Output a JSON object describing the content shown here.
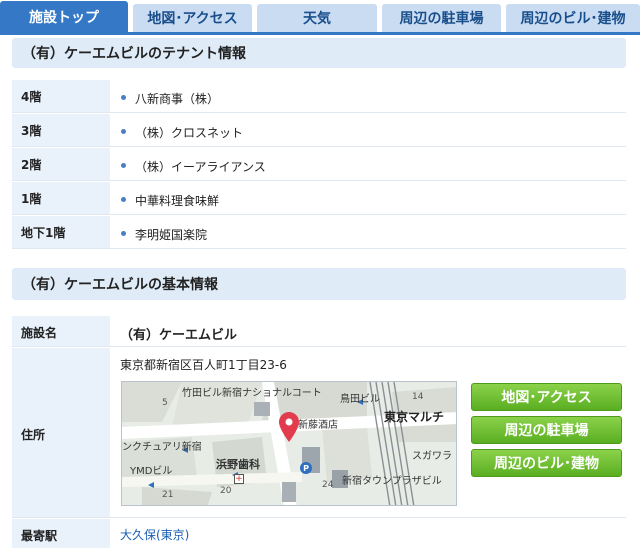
{
  "tabs": [
    {
      "label": "施設トップ",
      "active": true
    },
    {
      "label": "地図･アクセス",
      "active": false
    },
    {
      "label": "天気",
      "active": false
    },
    {
      "label": "周辺の駐車場",
      "active": false
    },
    {
      "label": "周辺のビル･建物",
      "active": false
    }
  ],
  "tenant_section": {
    "title": "（有）ケーエムビルのテナント情報",
    "rows": [
      {
        "floor": "4階",
        "tenant": "八新商事（株）"
      },
      {
        "floor": "3階",
        "tenant": "（株）クロスネット"
      },
      {
        "floor": "2階",
        "tenant": "（株）イーアライアンス"
      },
      {
        "floor": "1階",
        "tenant": "中華料理食味鮮"
      },
      {
        "floor": "地下1階",
        "tenant": "李明姫国楽院"
      }
    ]
  },
  "basic_section": {
    "title": "（有）ケーエムビルの基本情報",
    "facility_label": "施設名",
    "facility_name": "（有）ケーエムビル",
    "address_label": "住所",
    "address": "東京都新宿区百人町1丁目23-6",
    "station_label": "最寄駅",
    "station": "大久保(東京)"
  },
  "map_labels": {
    "l1": "竹田ビル新宿ナショナルコート",
    "l2": "鳥田ビル",
    "l3": "新藤酒店",
    "l4": "東京マルチ",
    "l5": "ンクチュアリ新宿",
    "l6": "浜野歯科",
    "l7": "YMDビル",
    "l8": "スガワラ",
    "l9": "新宿タウンプラザビル",
    "n5": "5",
    "n14": "14",
    "n20": "20",
    "n21": "21",
    "n24": "24",
    "p": "P"
  },
  "buttons": {
    "map_access": "地図･アクセス",
    "parking": "周辺の駐車場",
    "buildings": "周辺のビル･建物"
  },
  "colors": {
    "tab_active": "#3579c6",
    "tab_inactive": "#c9dcf2",
    "section_bg": "#dfebf7",
    "label_bg": "#e9f1fa",
    "button_green": "#6cbf2e",
    "pin_red": "#e23b4e"
  }
}
